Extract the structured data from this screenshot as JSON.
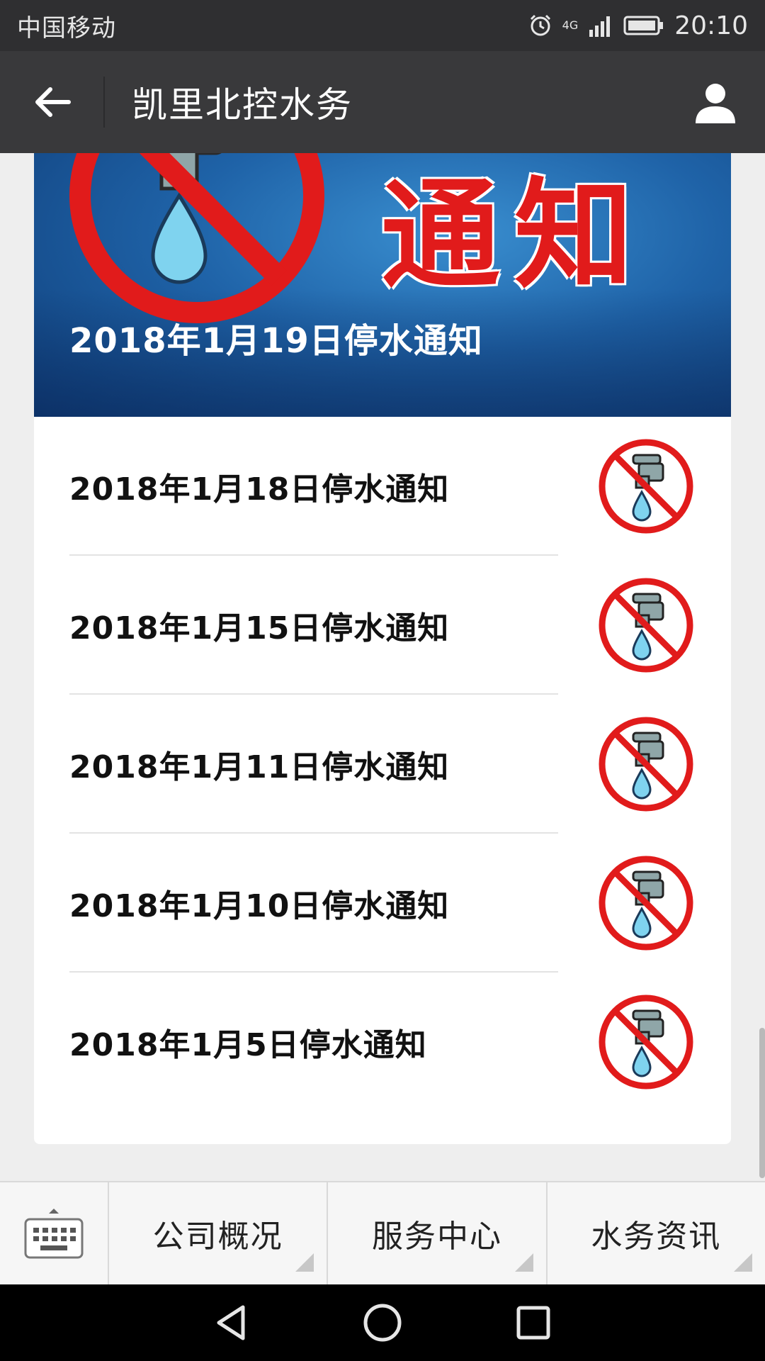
{
  "status_bar": {
    "carrier": "中国移动",
    "network": "4G",
    "time": "20:10"
  },
  "nav": {
    "title": "凯里北控水务"
  },
  "banner": {
    "big_text": "通知",
    "title": "2018年1月19日停水通知"
  },
  "notices": [
    {
      "title": "2018年1月18日停水通知"
    },
    {
      "title": "2018年1月15日停水通知"
    },
    {
      "title": "2018年1月11日停水通知"
    },
    {
      "title": "2018年1月10日停水通知"
    },
    {
      "title": "2018年1月5日停水通知"
    }
  ],
  "bottom_menu": {
    "items": [
      {
        "label": "公司概况"
      },
      {
        "label": "服务中心"
      },
      {
        "label": "水务资讯"
      }
    ]
  },
  "colors": {
    "status_bar": "#2f2f31",
    "nav_bar": "#39393b",
    "prohibit_red": "#e11b1b",
    "banner_blue": "#1f63a8"
  },
  "icons": {
    "back": "arrow-left-icon",
    "profile": "person-icon",
    "alarm": "alarm-icon",
    "signal": "signal-icon",
    "battery": "battery-icon",
    "keyboard": "keyboard-icon",
    "no_water": "no-water-faucet-icon",
    "sys_back": "triangle-back-icon",
    "sys_home": "circle-home-icon",
    "sys_recent": "square-recent-icon"
  }
}
